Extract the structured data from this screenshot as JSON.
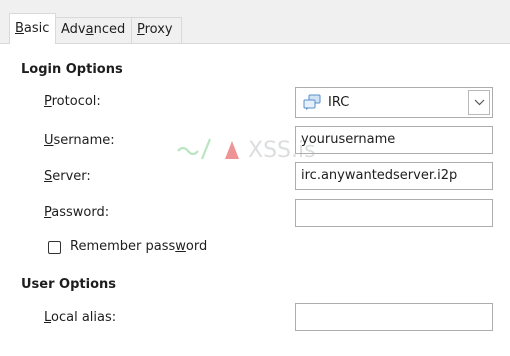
{
  "tabs": [
    {
      "label": "Basic",
      "accel": "B",
      "rest": "asic",
      "active": true
    },
    {
      "label": "Advanced",
      "pre": "Adv",
      "accel": "a",
      "rest": "nced"
    },
    {
      "label": "Proxy",
      "accel": "P",
      "rest": "roxy"
    }
  ],
  "login": {
    "title": "Login Options",
    "protocol": {
      "label_accel": "P",
      "label_rest": "rotocol:",
      "value": "IRC",
      "icon": "chat-bubbles-icon"
    },
    "username": {
      "label_accel": "U",
      "label_rest": "sername:",
      "value": "yourusername"
    },
    "server": {
      "label_accel": "S",
      "label_rest": "erver:",
      "value": "irc.anywantedserver.i2p"
    },
    "password": {
      "label_accel": "P",
      "label_rest": "assword:",
      "value": ""
    },
    "remember": {
      "label_pre": "Remember pass",
      "label_accel": "w",
      "label_rest": "ord",
      "checked": false
    }
  },
  "user": {
    "title": "User Options",
    "alias": {
      "label_accel": "L",
      "label_rest": "ocal alias:",
      "value": ""
    }
  },
  "watermark": {
    "text": "XSS.is"
  },
  "colors": {
    "border": "#adadad",
    "tab_bg": "#f0f0f0",
    "watermark_green": "#3fb34f",
    "watermark_red": "#e03c3c"
  }
}
